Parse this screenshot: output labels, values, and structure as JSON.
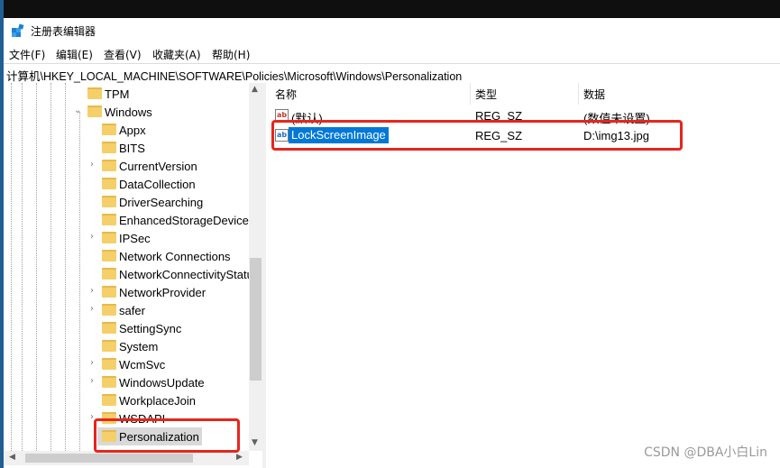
{
  "window": {
    "title": "注册表编辑器"
  },
  "menu": [
    "文件(F)",
    "编辑(E)",
    "查看(V)",
    "收藏夹(A)",
    "帮助(H)"
  ],
  "address": "计算机\\HKEY_LOCAL_MACHINE\\SOFTWARE\\Policies\\Microsoft\\Windows\\Personalization",
  "tree": {
    "items": [
      {
        "label": "TPM",
        "level": 1,
        "expand": "none"
      },
      {
        "label": "Windows",
        "level": 1,
        "expand": "open"
      },
      {
        "label": "Appx",
        "level": 2,
        "expand": "none"
      },
      {
        "label": "BITS",
        "level": 2,
        "expand": "none"
      },
      {
        "label": "CurrentVersion",
        "level": 2,
        "expand": "closed"
      },
      {
        "label": "DataCollection",
        "level": 2,
        "expand": "none"
      },
      {
        "label": "DriverSearching",
        "level": 2,
        "expand": "none"
      },
      {
        "label": "EnhancedStorageDevices",
        "level": 2,
        "expand": "none"
      },
      {
        "label": "IPSec",
        "level": 2,
        "expand": "closed"
      },
      {
        "label": "Network Connections",
        "level": 2,
        "expand": "none"
      },
      {
        "label": "NetworkConnectivityStatusIndicator",
        "level": 2,
        "expand": "none"
      },
      {
        "label": "NetworkProvider",
        "level": 2,
        "expand": "closed"
      },
      {
        "label": "safer",
        "level": 2,
        "expand": "closed"
      },
      {
        "label": "SettingSync",
        "level": 2,
        "expand": "none"
      },
      {
        "label": "System",
        "level": 2,
        "expand": "none"
      },
      {
        "label": "WcmSvc",
        "level": 2,
        "expand": "closed"
      },
      {
        "label": "WindowsUpdate",
        "level": 2,
        "expand": "closed"
      },
      {
        "label": "WorkplaceJoin",
        "level": 2,
        "expand": "none"
      },
      {
        "label": "WSDAPI",
        "level": 2,
        "expand": "closed"
      },
      {
        "label": "Personalization",
        "level": 2,
        "expand": "none",
        "selected": true
      }
    ]
  },
  "list": {
    "columns": [
      "名称",
      "类型",
      "数据"
    ],
    "rows": [
      {
        "name": "(默认)",
        "type": "REG_SZ",
        "data": "(数值未设置)",
        "selected": false
      },
      {
        "name": "LockScreenImage",
        "type": "REG_SZ",
        "data": "D:\\img13.jpg",
        "selected": true
      }
    ]
  },
  "colors": {
    "selection": "#0078d7",
    "highlight_box": "#e8251c",
    "folder": "#f5cf6a"
  },
  "watermark": "CSDN @DBA小白Lin"
}
